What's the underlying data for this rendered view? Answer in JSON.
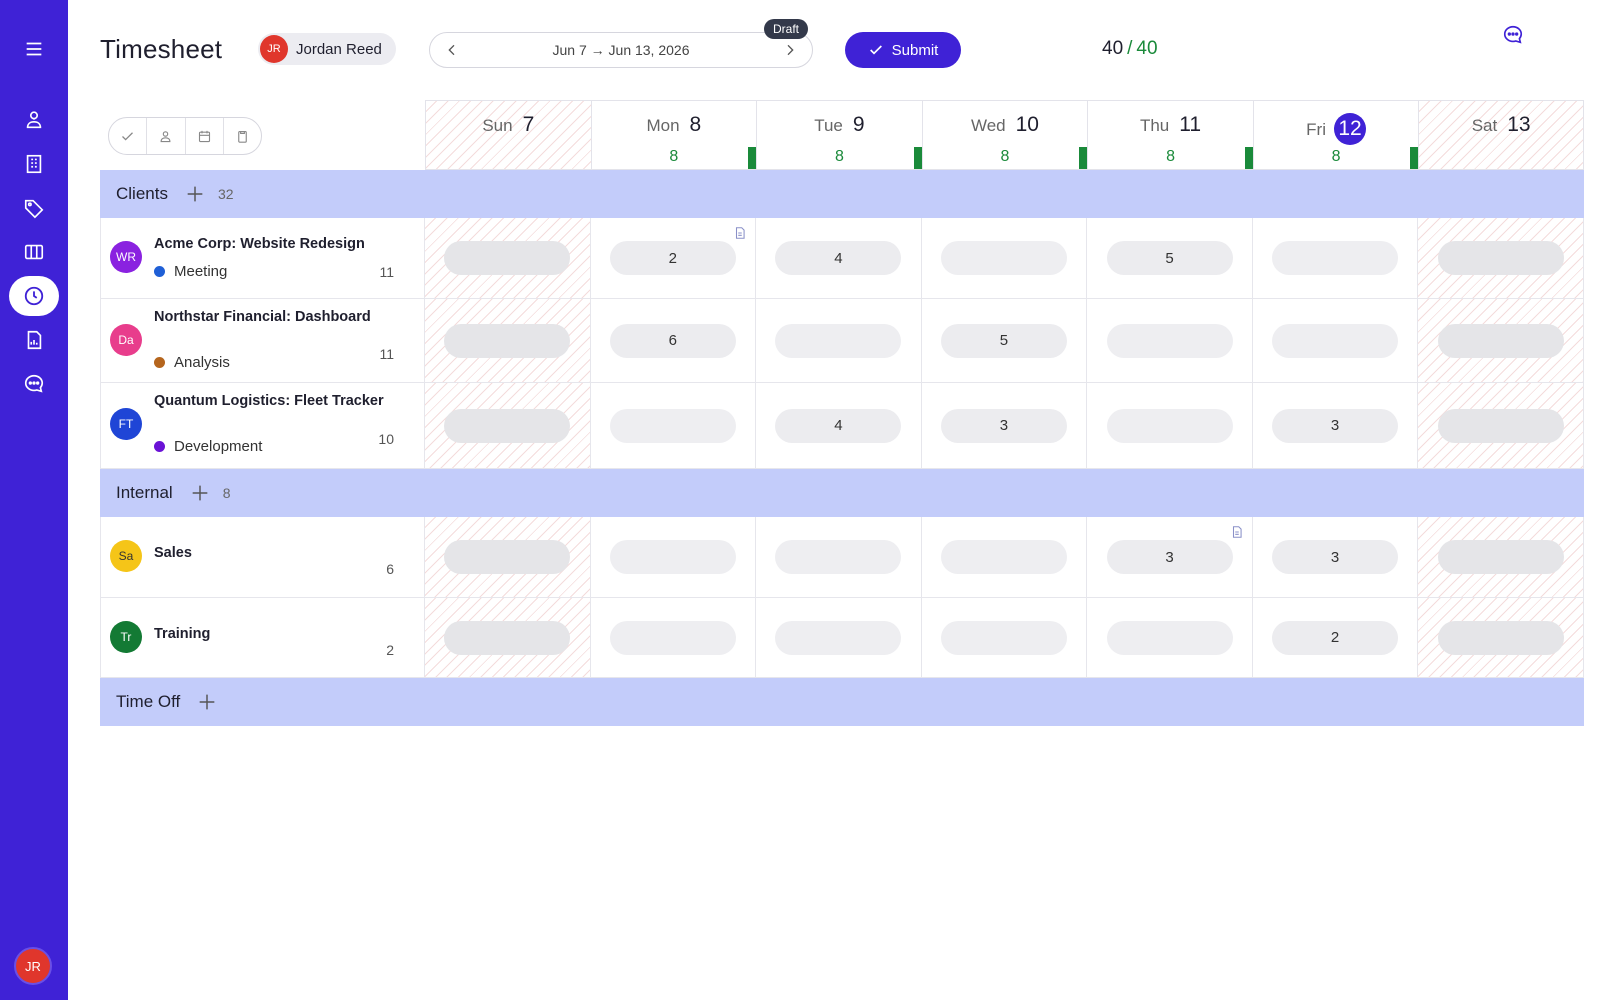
{
  "app": {
    "title": "Timesheet"
  },
  "user": {
    "initials": "JR",
    "name": "Jordan Reed",
    "avatar_color": "#e0362c"
  },
  "period": {
    "range": "Jun 7 → Jun 13, 2026",
    "status": "Draft"
  },
  "actions": {
    "submit_label": "Submit"
  },
  "hours": {
    "logged": "40",
    "separator": "/",
    "target": "40"
  },
  "sidebar": {
    "items": [
      {
        "icon": "menu-icon"
      },
      {
        "icon": "people-icon"
      },
      {
        "icon": "building-icon"
      },
      {
        "icon": "tag-icon"
      },
      {
        "icon": "columns-icon"
      },
      {
        "icon": "clock-icon",
        "active": true
      },
      {
        "icon": "report-icon"
      },
      {
        "icon": "chat-icon"
      }
    ],
    "avatar_initials": "JR"
  },
  "days": [
    {
      "name": "Sun",
      "num": "7",
      "hours": "",
      "weekend": true
    },
    {
      "name": "Mon",
      "num": "8",
      "hours": "8"
    },
    {
      "name": "Tue",
      "num": "9",
      "hours": "8"
    },
    {
      "name": "Wed",
      "num": "10",
      "hours": "8"
    },
    {
      "name": "Thu",
      "num": "11",
      "hours": "8"
    },
    {
      "name": "Fri",
      "num": "12",
      "hours": "8",
      "today": true
    },
    {
      "name": "Sat",
      "num": "13",
      "hours": "",
      "weekend": true
    }
  ],
  "sections": [
    {
      "name": "Clients",
      "count": "32"
    },
    {
      "name": "Internal",
      "count": "8"
    },
    {
      "name": "Time Off",
      "count": ""
    }
  ],
  "rows": {
    "acme": {
      "initials": "WR",
      "color": "#8a22e0",
      "name": "Acme Corp: Website Redesign",
      "activity": "Meeting",
      "activity_color": "#1f5fd6",
      "total": "11",
      "cells": [
        "",
        "2",
        "4",
        "",
        "5",
        "",
        ""
      ]
    },
    "northstar": {
      "initials": "Da",
      "color": "#e83d8c",
      "name": "Northstar Financial: Dashboard",
      "activity": "Analysis",
      "activity_color": "#b5651d",
      "total": "11",
      "cells": [
        "",
        "6",
        "",
        "5",
        "",
        "",
        ""
      ]
    },
    "quantum": {
      "initials": "FT",
      "color": "#1f45d6",
      "name": "Quantum Logistics: Fleet Tracker",
      "activity": "Development",
      "activity_color": "#6a12d6",
      "total": "10",
      "cells": [
        "",
        "",
        "4",
        "3",
        "",
        "3",
        ""
      ]
    },
    "sales": {
      "initials": "Sa",
      "color": "#f5c518",
      "name": "Sales",
      "total": "6",
      "cells": [
        "",
        "",
        "",
        "",
        "3",
        "3",
        ""
      ]
    },
    "training": {
      "initials": "Tr",
      "color": "#137a34",
      "name": "Training",
      "total": "2",
      "cells": [
        "",
        "",
        "",
        "",
        "",
        "2",
        ""
      ]
    }
  }
}
